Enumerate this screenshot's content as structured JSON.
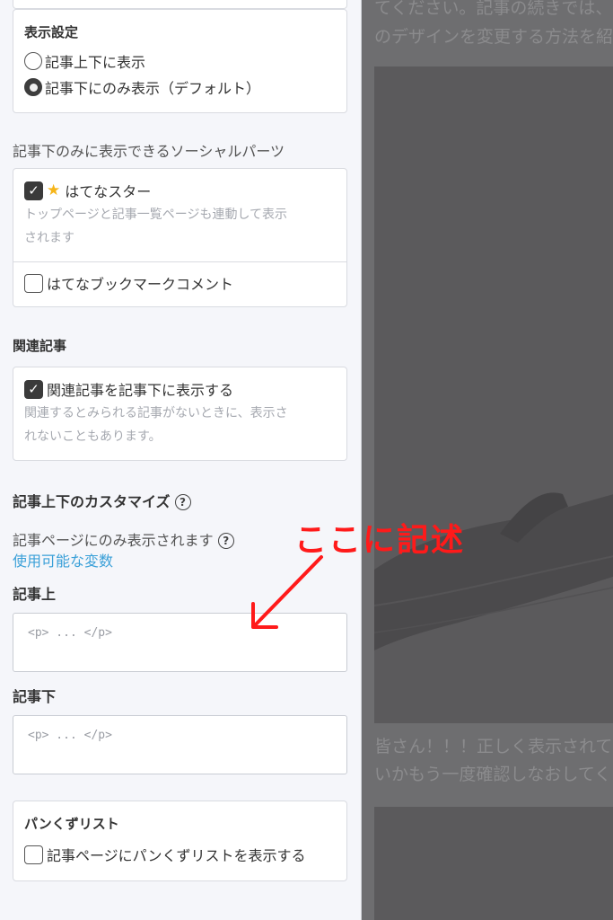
{
  "display_settings": {
    "title": "表示設定",
    "options": [
      {
        "label": "記事上下に表示",
        "checked": false
      },
      {
        "label": "記事下にのみ表示（デフォルト）",
        "checked": true
      }
    ]
  },
  "social_parts": {
    "label": "記事下のみに表示できるソーシャルパーツ",
    "hatena_star": {
      "label": "はてなスター",
      "checked": true,
      "note_line1": "トップページと記事一覧ページも連動して表示",
      "note_line2": "されます"
    },
    "bookmark_comment": {
      "label": "はてなブックマークコメント",
      "checked": false
    }
  },
  "related": {
    "heading": "関連記事",
    "option_label": "関連記事を記事下に表示する",
    "checked": true,
    "note_line1": "関連するとみられる記事がないときに、表示さ",
    "note_line2": "れないこともあります。"
  },
  "customize": {
    "heading": "記事上下のカスタマイズ",
    "subtitle": "記事ページにのみ表示されます",
    "link": "使用可能な変数",
    "top_label": "記事上",
    "top_placeholder": "<p> ... </p>",
    "bottom_label": "記事下",
    "bottom_placeholder": "<p> ... </p>"
  },
  "breadcrumb": {
    "title": "パンくずリスト",
    "option_label": "記事ページにパンくずリストを表示する",
    "checked": false
  },
  "annotation": {
    "text": "ここに記述",
    "color": "#ff1a1a"
  },
  "preview": {
    "line1": "てください。記事の続きでは、",
    "line2": "のデザインを変更する方法を紹",
    "line3": "皆さん！！！正しく表示されて",
    "line4": "いかもう一度確認しなおしてく"
  }
}
